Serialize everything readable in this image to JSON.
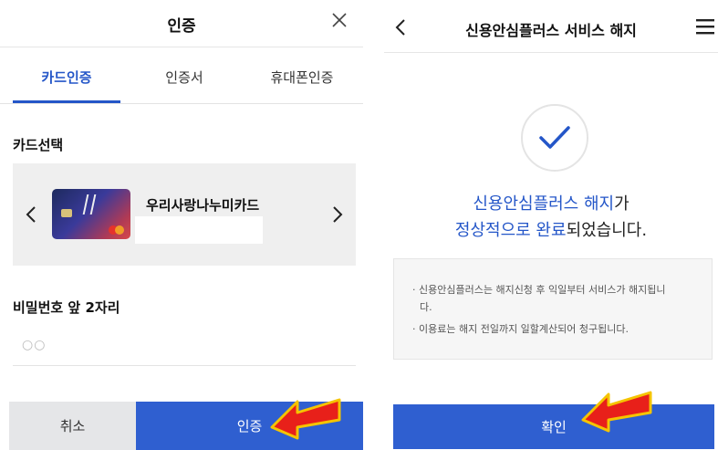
{
  "left": {
    "header": {
      "title": "인증"
    },
    "tabs": [
      {
        "label": "카드인증",
        "active": true
      },
      {
        "label": "인증서",
        "active": false
      },
      {
        "label": "휴대폰인증",
        "active": false
      }
    ],
    "card_section": {
      "label": "카드선택",
      "card_name": "우리사랑나누미카드"
    },
    "password_section": {
      "label": "비밀번호 앞 2자리",
      "placeholder": "○○"
    },
    "buttons": {
      "cancel": "취소",
      "authenticate": "인증"
    }
  },
  "right": {
    "header": {
      "title": "신용안심플러스 서비스 해지"
    },
    "message": {
      "line1_highlight": "신용안심플러스 해지",
      "line1_rest": "가",
      "line2_highlight": "정상적으로 완료",
      "line2_rest": "되었습니다."
    },
    "notice": {
      "item1_line1": "· 신용안심플러스는 해지신청 후 익일부터 서비스가 해지됩니",
      "item1_line2": "다.",
      "item2": "· 이용료는 해지 전일까지 일할계산되어 청구됩니다."
    },
    "buttons": {
      "confirm": "확인"
    }
  },
  "colors": {
    "accent": "#2456c8",
    "button_primary": "#2f5fd0",
    "button_secondary": "#e5e6e8",
    "pointer_arrow": "#e8201a",
    "pointer_outline": "#f5c400"
  }
}
